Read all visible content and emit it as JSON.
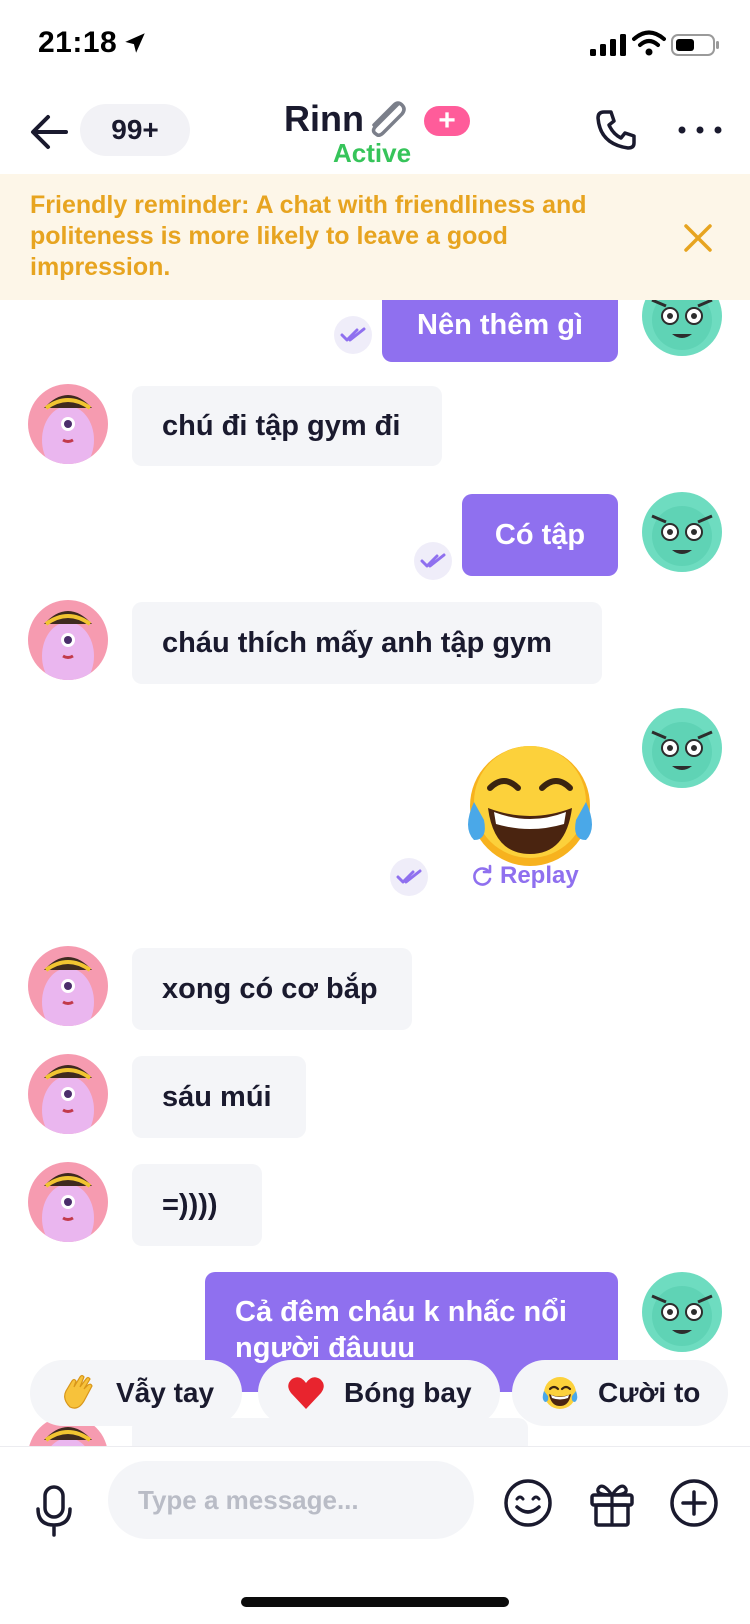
{
  "status_bar": {
    "time": "21:18"
  },
  "header": {
    "unread_count": "99+",
    "contact_name": "Rinn",
    "presence": "Active",
    "plus_badge": "+"
  },
  "reminder": {
    "text": "Friendly reminder: A chat with friendliness and politeness is more likely to leave a good impression."
  },
  "messages": [
    {
      "from": "me",
      "text": "Nên thêm gì"
    },
    {
      "from": "them",
      "text": "chú đi tập gym đi"
    },
    {
      "from": "me",
      "text": "Có tập"
    },
    {
      "from": "them",
      "text": "cháu thích mấy anh tập gym"
    },
    {
      "from": "me",
      "type": "sticker",
      "emoji": "face-with-tears-of-joy"
    },
    {
      "from": "them",
      "text": "xong có cơ bắp"
    },
    {
      "from": "them",
      "text": "sáu múi"
    },
    {
      "from": "them",
      "text": "=))))"
    },
    {
      "from": "me",
      "text": "Cả đêm cháu k nhấc nổi người đâuuu"
    }
  ],
  "sticker_actions": {
    "replay_label": "Replay"
  },
  "quick_reactions": [
    {
      "emoji": "waving-hand",
      "label": "Vẫy tay"
    },
    {
      "emoji": "red-heart",
      "label": "Bóng bay"
    },
    {
      "emoji": "face-with-tears-of-joy",
      "label": "Cười to"
    }
  ],
  "composer": {
    "placeholder": "Type a message..."
  },
  "colors": {
    "accent": "#8f70ef",
    "active_green": "#36c45a",
    "reminder_text": "#e7a420",
    "reminder_bg": "#fdf6e8",
    "badge_pink": "#ff5c9a",
    "incoming_bubble": "#f4f5f8"
  }
}
